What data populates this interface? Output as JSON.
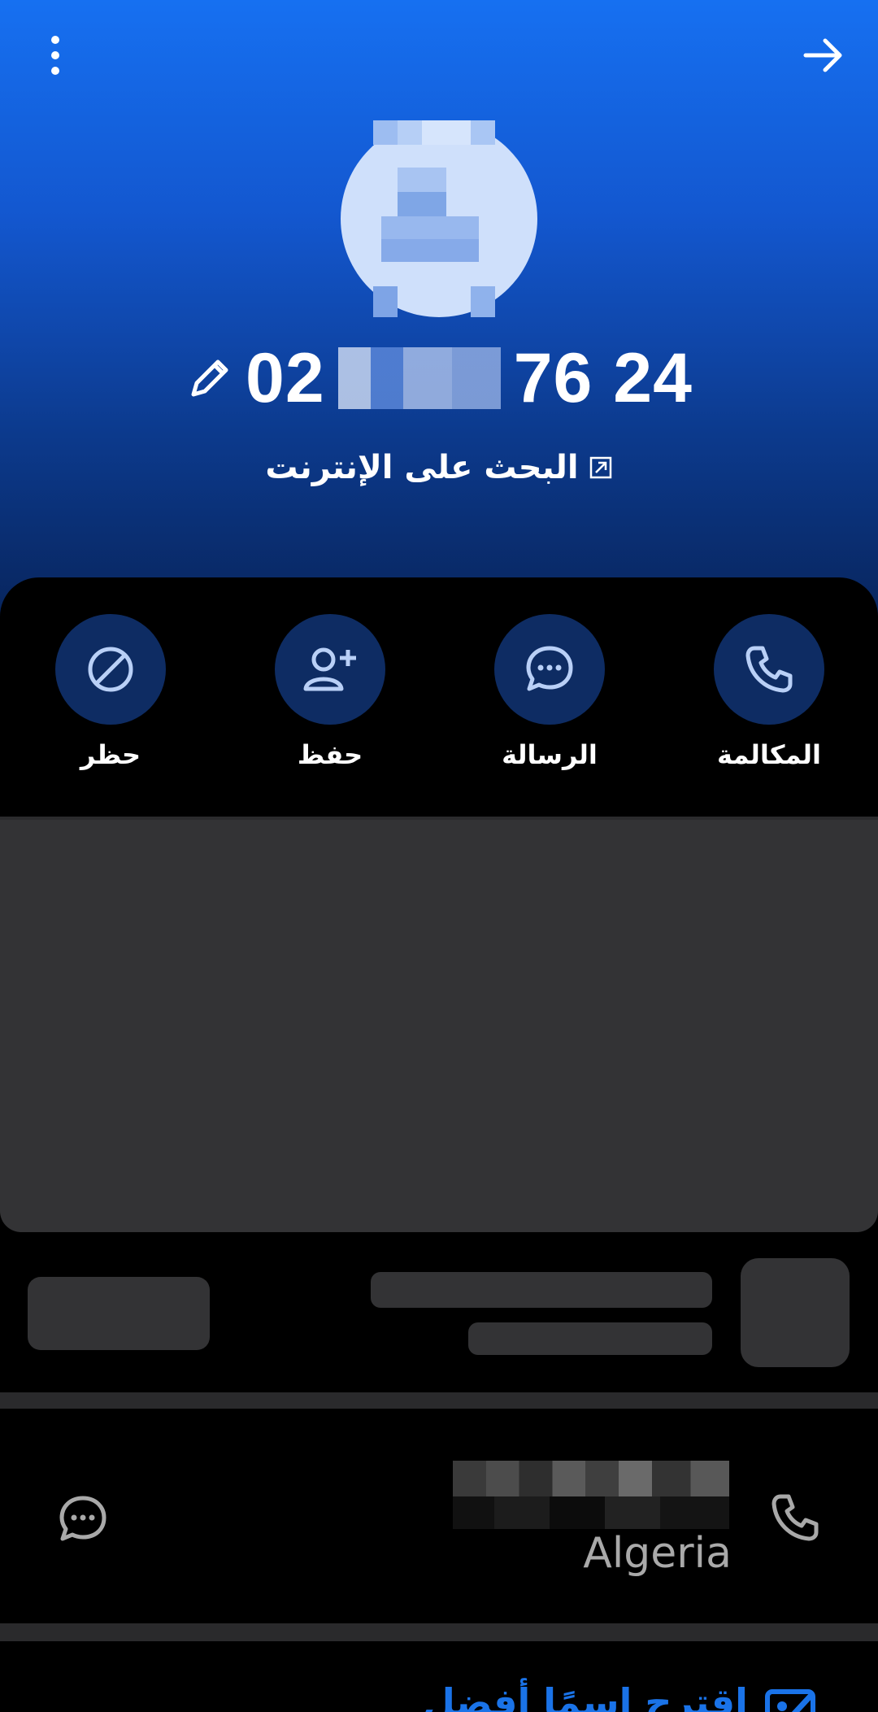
{
  "header": {
    "phone_number_prefix": "02",
    "phone_number_suffix": "76 24",
    "search_online_label": "البحث على الإنترنت"
  },
  "actions": [
    {
      "label": "حظر",
      "icon": "block-icon"
    },
    {
      "label": "حفظ",
      "icon": "add-contact-icon"
    },
    {
      "label": "الرسالة",
      "icon": "message-icon"
    },
    {
      "label": "المكالمة",
      "icon": "phone-icon"
    }
  ],
  "contact_row": {
    "country": "Algeria",
    "left_icon": "message-icon",
    "right_icon": "phone-icon"
  },
  "suggest": {
    "label": "اقترح اسمًا أفضل",
    "icon": "edit-name-icon"
  },
  "colors": {
    "accent": "#1a73e8",
    "bubble": "#0e2c63",
    "icon_light": "#b9d0f7"
  }
}
